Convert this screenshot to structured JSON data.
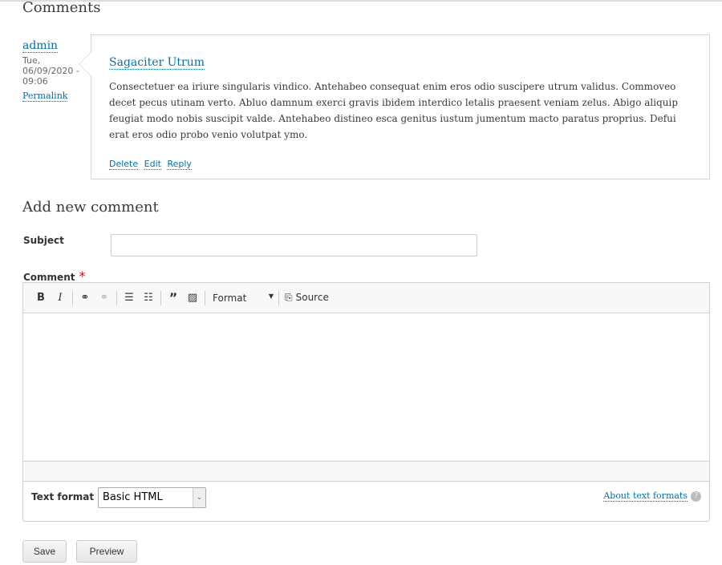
{
  "comments": {
    "heading": "Comments",
    "items": [
      {
        "author": "admin",
        "date": "Tue, 06/09/2020 - 09:06",
        "permalink": "Permalink",
        "title": "Sagaciter Utrum",
        "body": "Consectetuer ea iriure singularis vindico. Antehabeo consequat enim eros odio suscipere utrum validus. Commoveo decet pecus utinam verto. Abluo damnum exerci gravis ibidem interdico letalis praesent veniam zelus. Abigo aliquip feugiat modo nobis suscipit valde. Antehabeo distineo esca genitus iustum jumentum macto paratus proprius. Defui erat eros odio probo venio volutpat ymo.",
        "links": [
          "Delete",
          "Edit",
          "Reply"
        ]
      }
    ]
  },
  "form": {
    "heading": "Add new comment",
    "subject_label": "Subject",
    "subject_value": "",
    "comment_label": "Comment",
    "required_mark": "*",
    "toolbar": {
      "format_label": "Format",
      "source_label": "Source",
      "bold": "B",
      "italic": "I"
    },
    "text_format_label": "Text format",
    "text_format_value": "Basic HTML",
    "about_link": "About text formats",
    "help": "?",
    "save": "Save",
    "preview": "Preview"
  }
}
